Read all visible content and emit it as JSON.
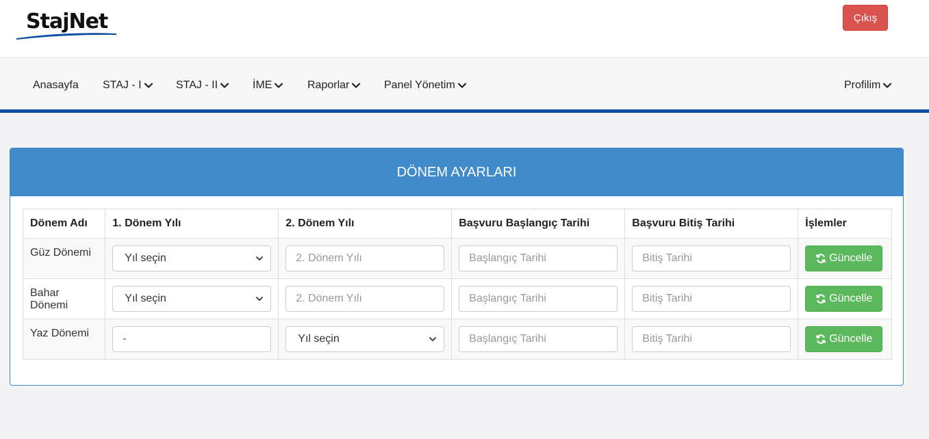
{
  "header": {
    "logo_text": "StajNet",
    "logout_label": "Çıkış"
  },
  "nav": {
    "items": [
      {
        "label": "Anasayfa",
        "dropdown": false
      },
      {
        "label": "STAJ - I",
        "dropdown": true
      },
      {
        "label": "STAJ - II",
        "dropdown": true
      },
      {
        "label": "İME",
        "dropdown": true
      },
      {
        "label": "Raporlar",
        "dropdown": true
      },
      {
        "label": "Panel Yönetim",
        "dropdown": true
      }
    ],
    "profile_label": "Profilim"
  },
  "panel": {
    "title": "DÖNEM AYARLARI"
  },
  "table": {
    "headers": [
      "Dönem Adı",
      "1. Dönem Yılı",
      "2. Dönem Yılı",
      "Başvuru Başlangıç Tarihi",
      "Başvuru Bitiş Tarihi",
      "İşlemler"
    ],
    "rows": [
      {
        "name": "Güz Dönemi",
        "year1": "Yıl seçin",
        "year2_placeholder": "2. Dönem Yılı",
        "start_placeholder": "Başlangıç Tarihi",
        "end_placeholder": "Bitiş Tarihi",
        "action": "Güncelle"
      },
      {
        "name": "Bahar Dönemi",
        "year1": "Yıl seçin",
        "year2_placeholder": "2. Dönem Yılı",
        "start_placeholder": "Başlangıç Tarihi",
        "end_placeholder": "Bitiş Tarihi",
        "action": "Güncelle"
      },
      {
        "name": "Yaz Dönemi",
        "year1_value": "-",
        "year2": "Yıl seçin",
        "start_placeholder": "Başlangıç Tarihi",
        "end_placeholder": "Bitiş Tarihi",
        "action": "Güncelle"
      }
    ]
  },
  "colors": {
    "brand_blue": "#428bca",
    "nav_border": "#0b4ea2",
    "danger": "#d9534f",
    "success": "#5cb85c"
  },
  "icons": {
    "chevron": "chevron-down-icon",
    "refresh": "refresh-icon"
  }
}
